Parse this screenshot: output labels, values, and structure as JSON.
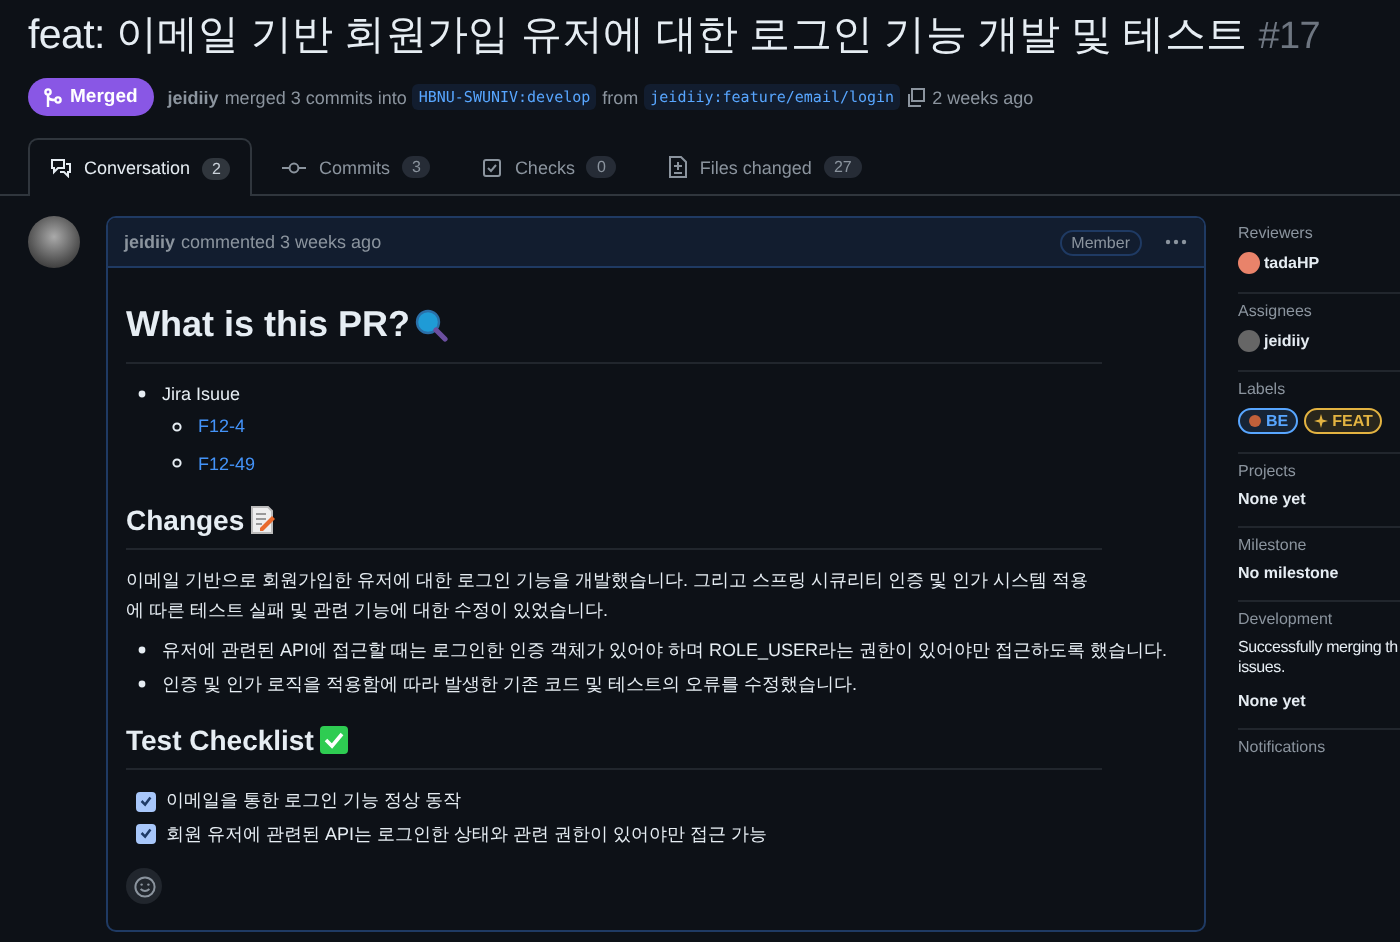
{
  "title": {
    "text": "feat: 이메일 기반 회원가입 유저에 대한 로그인 기능 개발 및 테스트",
    "number": "#17"
  },
  "status": {
    "badge": "Merged",
    "author": "jeidiiy",
    "action": "merged 3 commits into",
    "base": "HBNU-SWUNIV:develop",
    "from": "from",
    "head": "jeidiiy:feature/email/login",
    "time": "2 weeks ago"
  },
  "tabs": [
    {
      "label": "Conversation",
      "count": "2",
      "selected": true,
      "kind": "conversation"
    },
    {
      "label": "Commits",
      "count": "3",
      "selected": false,
      "kind": "commits"
    },
    {
      "label": "Checks",
      "count": "0",
      "selected": false,
      "kind": "checks"
    },
    {
      "label": "Files changed",
      "count": "27",
      "selected": false,
      "kind": "files"
    }
  ],
  "comment": {
    "author": "jeidiiy",
    "meta": "commented 3 weeks ago",
    "role": "Member",
    "heading1": "What is this PR?",
    "jira": "Jira Isuue",
    "issues": [
      "F12-4",
      "F12-49"
    ],
    "heading2": "Changes",
    "paragraph": "이메일 기반으로 회원가입한 유저에 대한 로그인 기능을 개발했습니다. 그리고 스프링 시큐리티 인증 및 인가 시스템 적용에 따른 테스트 실패 및 관련 기능에 대한 수정이 있었습니다.",
    "bullets": [
      "유저에 관련된 API에 접근할 때는 로그인한 인증 객체가 있어야 하며 ROLE_USER라는 권한이 있어야만 접근하도록 했습니다.",
      "인증 및 인가 로직을 적용함에 따라 발생한 기존 코드 및 테스트의 오류를 수정했습니다."
    ],
    "heading3": "Test Checklist",
    "checklist": [
      {
        "text": "이메일을 통한 로그인 기능 정상 동작",
        "checked": true
      },
      {
        "text": "회원 유저에 관련된 API는 로그인한 상태와 관련 권한이 있어야만 접근 가능",
        "checked": true
      }
    ]
  },
  "sidebar": {
    "reviewers": {
      "heading": "Reviewers",
      "name": "tadaHP"
    },
    "assignees": {
      "heading": "Assignees",
      "name": "jeidiiy"
    },
    "labels": {
      "heading": "Labels",
      "items": [
        {
          "text": "BE",
          "color": "#58a6ff",
          "kind": "be"
        },
        {
          "text": "FEAT",
          "color": "#e3b341",
          "kind": "feat"
        }
      ]
    },
    "projects": {
      "heading": "Projects",
      "value": "None yet"
    },
    "milestone": {
      "heading": "Milestone",
      "value": "No milestone"
    },
    "development": {
      "heading": "Development",
      "lines": [
        "Successfully merging th",
        "issues."
      ],
      "value": "None yet"
    },
    "notifications": {
      "heading": "Notifications"
    }
  }
}
